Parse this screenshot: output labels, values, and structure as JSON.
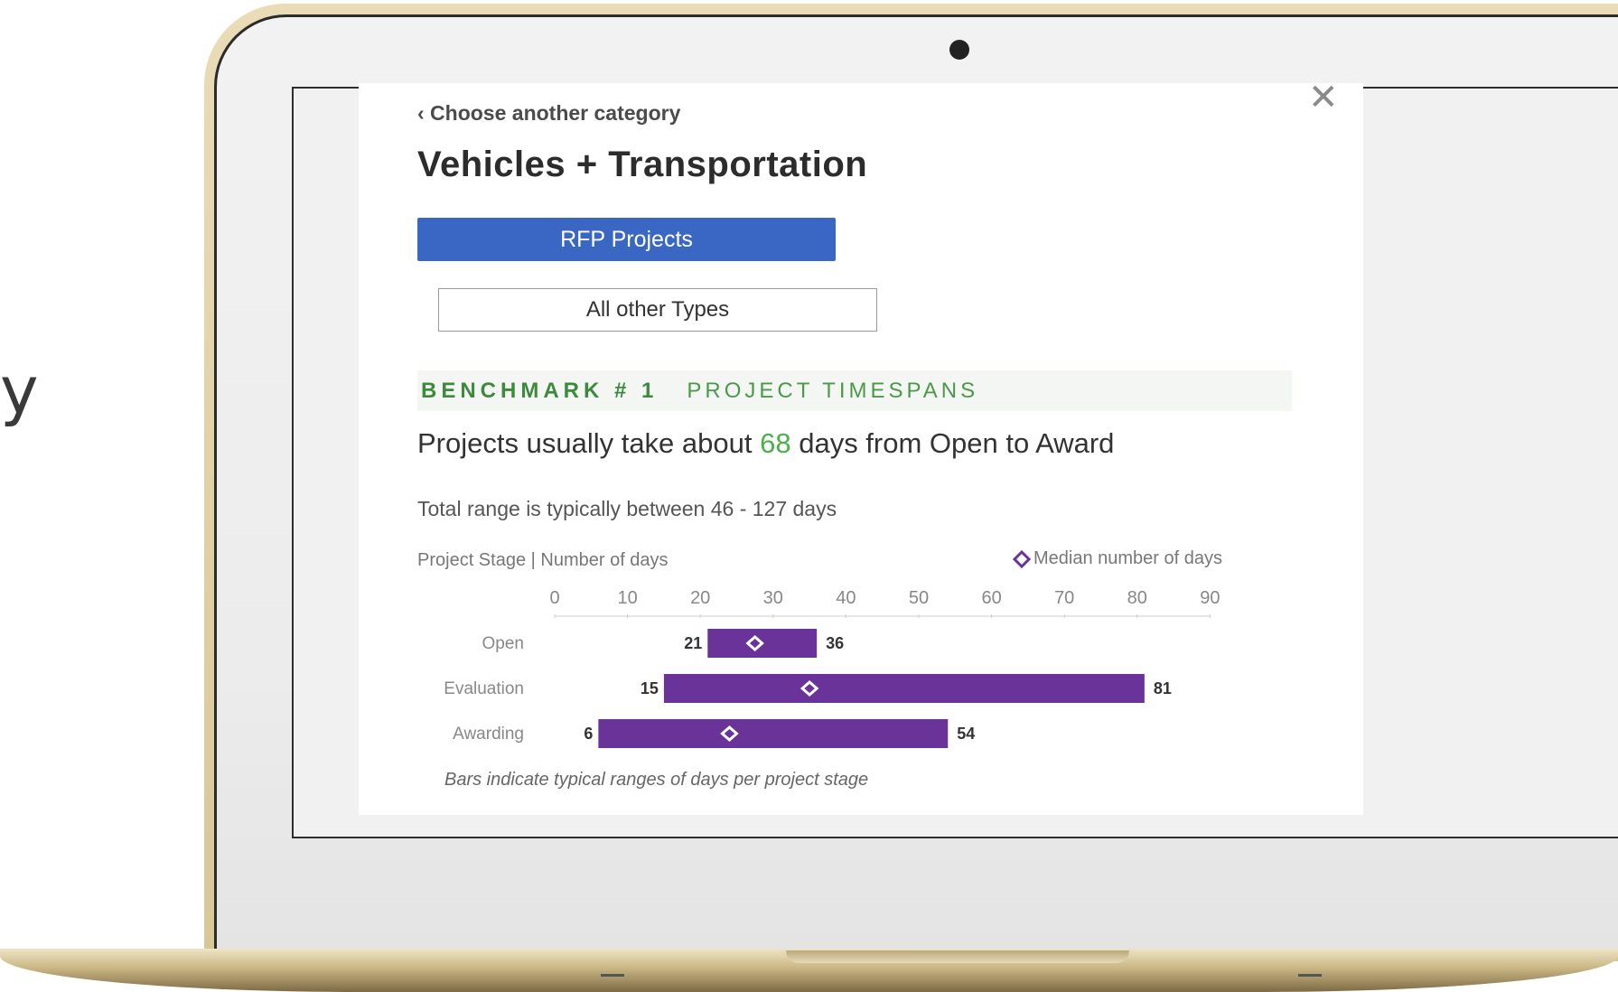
{
  "side_text": "y",
  "modal": {
    "back_link": "‹ Choose another category",
    "close_label": "✕",
    "title": "Vehicles + Transportation",
    "primary_button": "RFP Projects",
    "secondary_button": "All other Types",
    "benchmark": {
      "number": "BENCHMARK # 1",
      "label": "PROJECT TIMESPANS"
    },
    "headline": {
      "before": "Projects usually take about ",
      "value": "68",
      "after": " days from Open to Award"
    },
    "subline": "Total range is typically between 46 - 127 days",
    "legend_left": "Project Stage | Number of days",
    "legend_right": "Median number of days",
    "footnote": "Bars indicate typical ranges of days per project stage"
  },
  "colors": {
    "primary_button": "#3b67c4",
    "bar": "#6a339a",
    "benchmark_text": "#3d8a3d",
    "highlight": "#4ab04a"
  },
  "chart_data": {
    "type": "bar",
    "orientation": "horizontal-range",
    "x_ticks": [
      0,
      10,
      20,
      30,
      40,
      50,
      60,
      70,
      80,
      90
    ],
    "xlim": [
      0,
      90
    ],
    "categories": [
      "Open",
      "Evaluation",
      "Awarding"
    ],
    "ranges": [
      {
        "start": 21,
        "end": 36,
        "median": 27.5
      },
      {
        "start": 15,
        "end": 81,
        "median": 35
      },
      {
        "start": 6,
        "end": 54,
        "median": 24
      }
    ]
  }
}
